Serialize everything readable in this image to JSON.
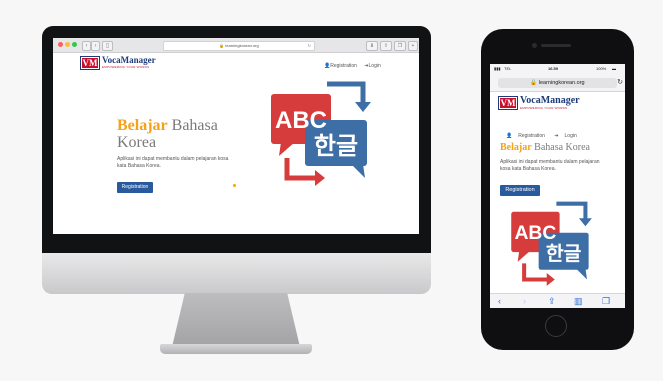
{
  "browser": {
    "url": "learningkorean.org",
    "dot_colors": [
      "#fc605c",
      "#fdbc40",
      "#34c84a"
    ]
  },
  "site": {
    "logo_mark": "VM",
    "logo_name": "VocaManager",
    "logo_tagline": "EMPOWERING YOUR WORDS",
    "nav": {
      "registration": "Registration",
      "login": "Login"
    },
    "hero": {
      "title_accent": "Belajar",
      "title_rest": " Bahasa Korea",
      "description": "Aplikasi ini dapat membantu dalam pelajaran kosa kata Bahasa Korea.",
      "button": "Registration"
    },
    "graphic": {
      "latin": "ABC",
      "hangul": "한글"
    },
    "colors": {
      "accent": "#f5a21a",
      "brand_blue": "#2a5a9e",
      "red_bubble": "#d63c3c",
      "blue_bubble": "#3d6fa6"
    }
  },
  "phone": {
    "carrier": "TEL",
    "time": "16.59",
    "battery": "100%",
    "url": "learningkorean.org"
  }
}
